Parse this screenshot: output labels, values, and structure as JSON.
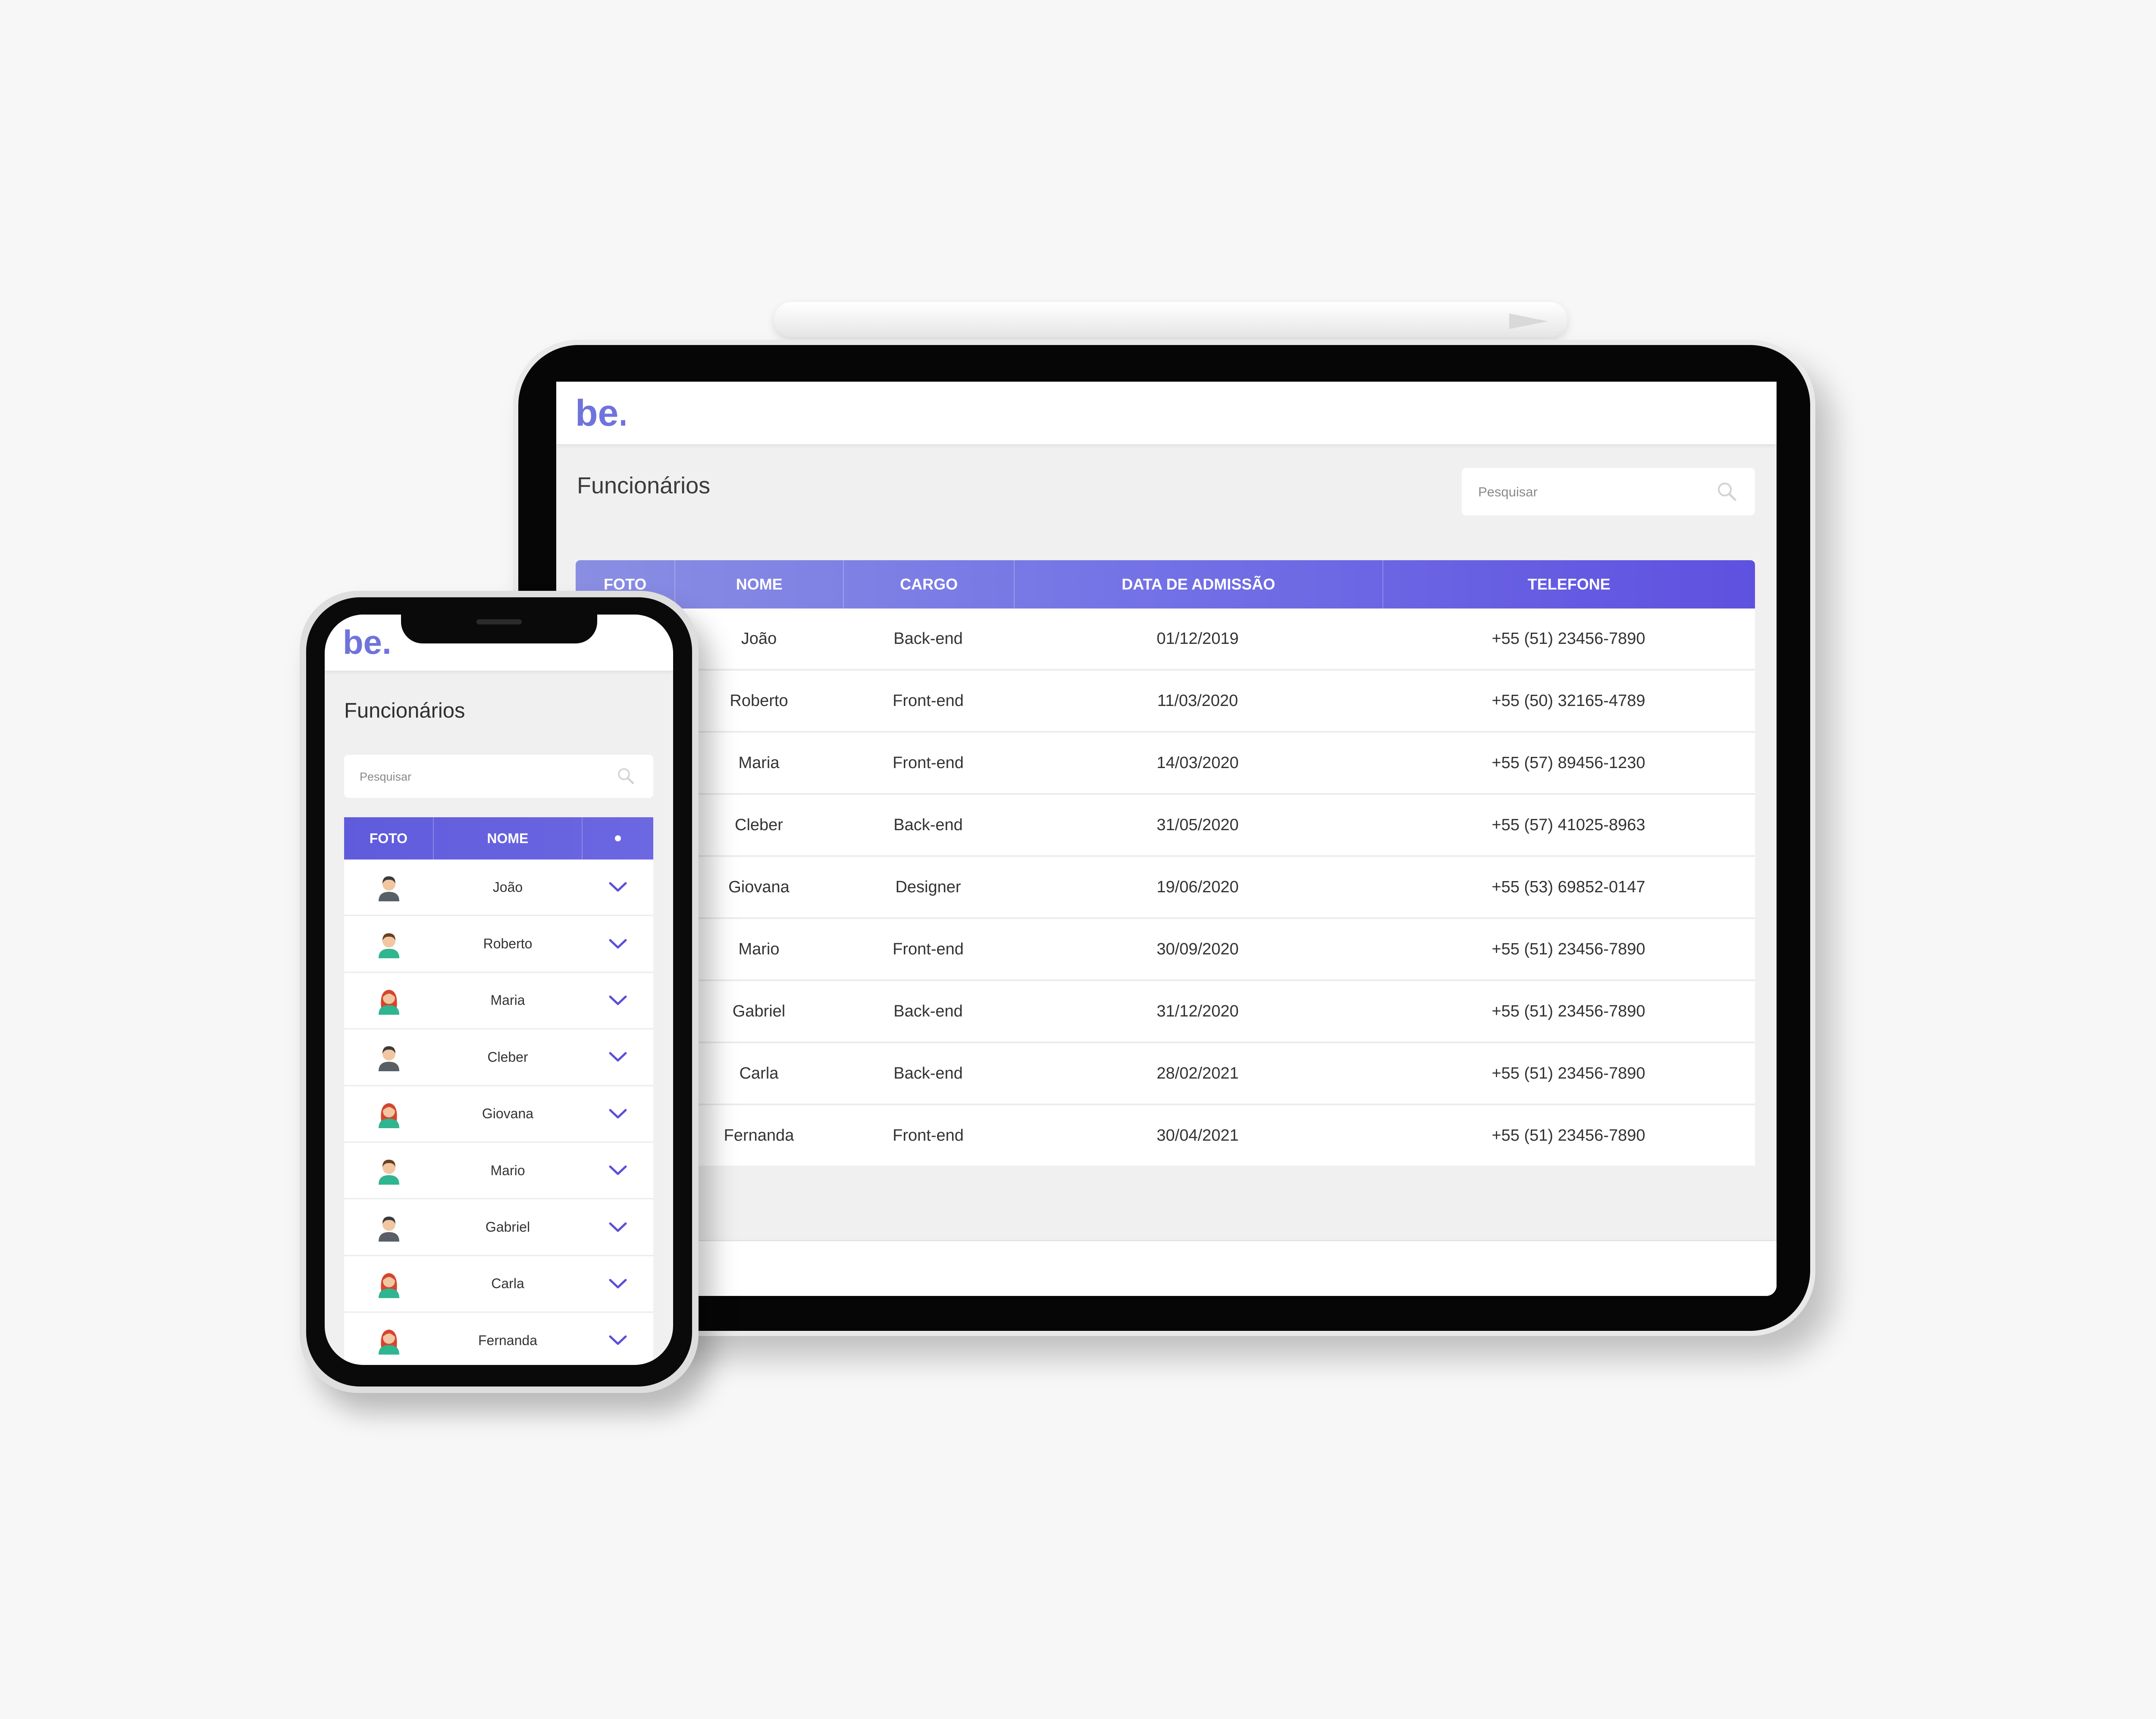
{
  "app": {
    "logo_text": "be.",
    "page_title": "Funcionários",
    "search": {
      "placeholder": "Pesquisar"
    }
  },
  "colors": {
    "accent": "#5e51e0",
    "header_gradient_start": "#8a8ee2",
    "header_gradient_end": "#5e51e0",
    "background": "#f0f0f0"
  },
  "tablet": {
    "columns": [
      "FOTO",
      "NOME",
      "CARGO",
      "DATA DE ADMISSÃO",
      "TELEFONE"
    ],
    "rows": [
      {
        "nome": "João",
        "cargo": "Back-end",
        "data": "01/12/2019",
        "telefone": "+55 (51) 23456-7890"
      },
      {
        "nome": "Roberto",
        "cargo": "Front-end",
        "data": "11/03/2020",
        "telefone": "+55 (50) 32165-4789"
      },
      {
        "nome": "Maria",
        "cargo": "Front-end",
        "data": "14/03/2020",
        "telefone": "+55 (57) 89456-1230"
      },
      {
        "nome": "Cleber",
        "cargo": "Back-end",
        "data": "31/05/2020",
        "telefone": "+55 (57) 41025-8963"
      },
      {
        "nome": "Giovana",
        "cargo": "Designer",
        "data": "19/06/2020",
        "telefone": "+55 (53) 69852-0147"
      },
      {
        "nome": "Mario",
        "cargo": "Front-end",
        "data": "30/09/2020",
        "telefone": "+55 (51) 23456-7890"
      },
      {
        "nome": "Gabriel",
        "cargo": "Back-end",
        "data": "31/12/2020",
        "telefone": "+55 (51) 23456-7890"
      },
      {
        "nome": "Carla",
        "cargo": "Back-end",
        "data": "28/02/2021",
        "telefone": "+55 (51) 23456-7890"
      },
      {
        "nome": "Fernanda",
        "cargo": "Front-end",
        "data": "30/04/2021",
        "telefone": "+55 (51) 23456-7890"
      }
    ]
  },
  "phone": {
    "columns": [
      "FOTO",
      "NOME"
    ],
    "rows": [
      {
        "nome": "João",
        "avatar": "male-dark-hair-avatar-icon"
      },
      {
        "nome": "Roberto",
        "avatar": "male-brown-hair-avatar-icon"
      },
      {
        "nome": "Maria",
        "avatar": "female-red-hair-avatar-icon"
      },
      {
        "nome": "Cleber",
        "avatar": "male-dark-hair-avatar-icon"
      },
      {
        "nome": "Giovana",
        "avatar": "female-red-hair-avatar-icon"
      },
      {
        "nome": "Mario",
        "avatar": "male-brown-hair-avatar-icon"
      },
      {
        "nome": "Gabriel",
        "avatar": "male-dark-hair-avatar-icon"
      },
      {
        "nome": "Carla",
        "avatar": "female-red-hair-avatar-icon"
      },
      {
        "nome": "Fernanda",
        "avatar": "female-red-hair-avatar-icon"
      }
    ]
  }
}
